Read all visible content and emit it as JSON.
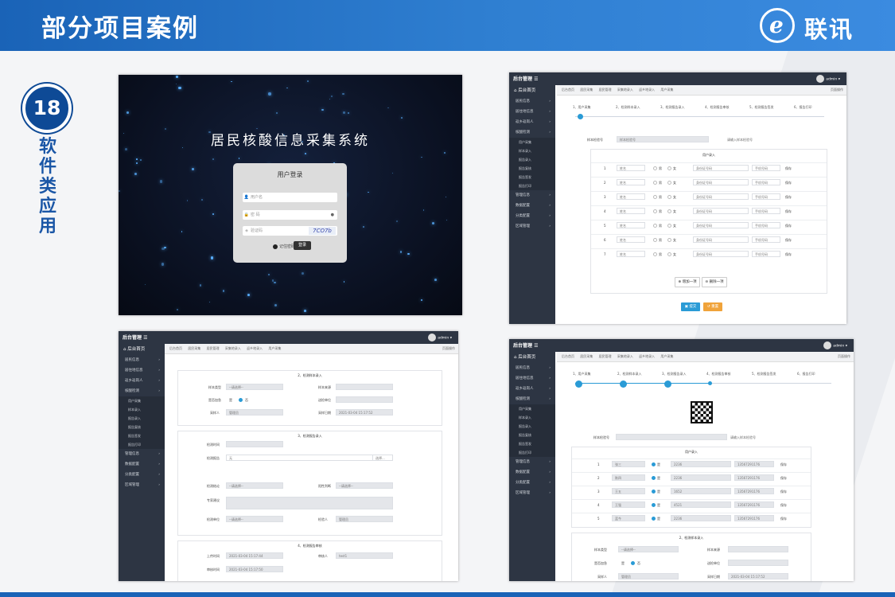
{
  "header": {
    "title": "部分项目案例",
    "logo_text": "联讯",
    "logo_glyph": "e"
  },
  "badge": {
    "number": "18"
  },
  "category": [
    "软",
    "件",
    "类",
    "应",
    "用"
  ],
  "colors": {
    "brand_blue": "#1a63b7",
    "dark_nav": "#2d3543",
    "accent": "#2a9bd6",
    "submit_blue": "#2a9bd6",
    "reset_orange": "#f0a33a"
  },
  "login": {
    "system_title": "居民核酸信息采集系统",
    "box_title": "用户登录",
    "username_placeholder": "用户名",
    "password_placeholder": "密 码",
    "captcha_placeholder": "验证码",
    "captcha_text": "7CO7b",
    "remember_label": "记住密码",
    "login_button": "登录"
  },
  "admin": {
    "brand": "后台管理",
    "user": "admin",
    "home": "后台首页",
    "menu": [
      "居民信息",
      "居住地信息",
      "返乡返岗人",
      "核酸检测"
    ],
    "submenu": [
      "用户采集",
      "样本录入",
      "报告录入",
      "报告复核",
      "报告签发",
      "报告打印"
    ],
    "menu2": [
      "管理信息",
      "数据配置",
      "分类配置",
      "区域管理"
    ],
    "tabs": [
      "后台首页",
      "居民采集",
      "居民管理",
      "采集地录入",
      "返乡地录入",
      "用户采集"
    ],
    "page_ops": "页面操作",
    "steps": [
      "1、用户采集",
      "2、检测样本录入",
      "3、检测报告录入",
      "4、检测报告审核",
      "5、检测报告签发",
      "6、报告打印"
    ],
    "sample_no_label": "样本检验号",
    "sample_no_placeholder": "样本检验号",
    "sample_hint": "请输入样本检验号",
    "user_entry_title": "用户录入",
    "rows": [
      {
        "no": "1",
        "name": "姓名",
        "id": "身份证号码",
        "phone": "手机号码",
        "male": "男",
        "female": "女",
        "save": "保存"
      },
      {
        "no": "2",
        "name": "姓名",
        "id": "身份证号码",
        "phone": "手机号码",
        "male": "男",
        "female": "女",
        "save": "保存"
      },
      {
        "no": "3",
        "name": "姓名",
        "id": "身份证号码",
        "phone": "手机号码",
        "male": "男",
        "female": "女",
        "save": "保存"
      },
      {
        "no": "4",
        "name": "姓名",
        "id": "身份证号码",
        "phone": "手机号码",
        "male": "男",
        "female": "女",
        "save": "保存"
      },
      {
        "no": "5",
        "name": "姓名",
        "id": "身份证号码",
        "phone": "手机号码",
        "male": "男",
        "female": "女",
        "save": "保存"
      },
      {
        "no": "6",
        "name": "姓名",
        "id": "身份证号码",
        "phone": "手机号码",
        "male": "男",
        "female": "女",
        "save": "保存"
      },
      {
        "no": "7",
        "name": "姓名",
        "id": "身份证号码",
        "phone": "手机号码",
        "male": "男",
        "female": "女",
        "save": "保存"
      }
    ],
    "add_one": "增加一项",
    "remove_one": "删除一项",
    "submit": "提交",
    "reset": "重置",
    "sample_section_title": "2、检测样本录入",
    "report_section_title": "3、检测报告录入",
    "review_section_title": "4、检测报告审核",
    "sample_type_label": "样本类型",
    "sample_source_label": "样本来源",
    "urgent_label": "是否加急",
    "unit_label": "送检单位",
    "collector_label": "采样人",
    "collect_date_label": "采样日期",
    "collector_value": "管理员",
    "collect_date_value": "2021-03-04 15:17:52",
    "select_placeholder": "--请选择--",
    "yes": "是",
    "no": "否",
    "check_time_label": "检测时间",
    "report_label": "检测报告",
    "report_file": "无",
    "choose_file": "选择...",
    "check_result_label": "检测结论",
    "judge_label": "阳性判断",
    "advice_label": "专家建议",
    "check_unit_label": "检测单位",
    "checker_label": "检验人",
    "checker_value": "管理员",
    "submit_time_label": "上传时间",
    "submit_time_value": "2021-03-04 15:17:44",
    "reviewer_label": "审核人",
    "reviewer_value": "test1",
    "review_time_label": "审核时间",
    "review_time_value": "2021-03-04 15:17:50",
    "rows4": [
      {
        "no": "1",
        "name": "张三",
        "id": "2236",
        "phone": "13567291176"
      },
      {
        "no": "2",
        "name": "陈四",
        "id": "2236",
        "phone": "13567291176"
      },
      {
        "no": "3",
        "name": "王五",
        "id": "1652",
        "phone": "13567291176"
      },
      {
        "no": "4",
        "name": "王强",
        "id": "4521",
        "phone": "13567291176"
      },
      {
        "no": "5",
        "name": "蓝今",
        "id": "2236",
        "phone": "13567291176"
      }
    ]
  }
}
